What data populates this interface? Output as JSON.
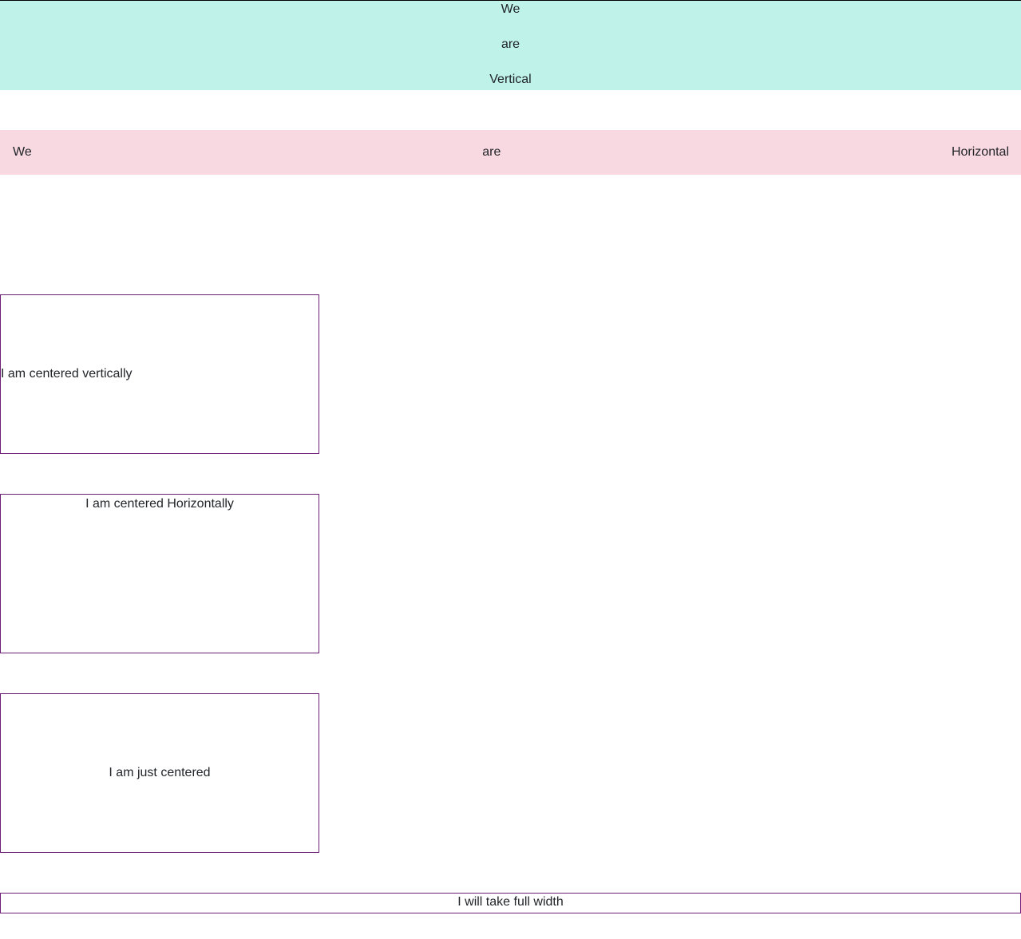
{
  "vertical": {
    "words": [
      "We",
      "are",
      "Vertical"
    ],
    "background": "#bff2e9"
  },
  "horizontal": {
    "words": [
      "We",
      "are",
      "Horizontal"
    ],
    "background": "#f9d9e1"
  },
  "boxes": {
    "border_color": "#6c1f74",
    "vertical_label": "I am centered vertically",
    "horizontal_label": "I am centered Horizontally",
    "center_label": "I am just centered",
    "full_width_label": "I will take full width"
  }
}
